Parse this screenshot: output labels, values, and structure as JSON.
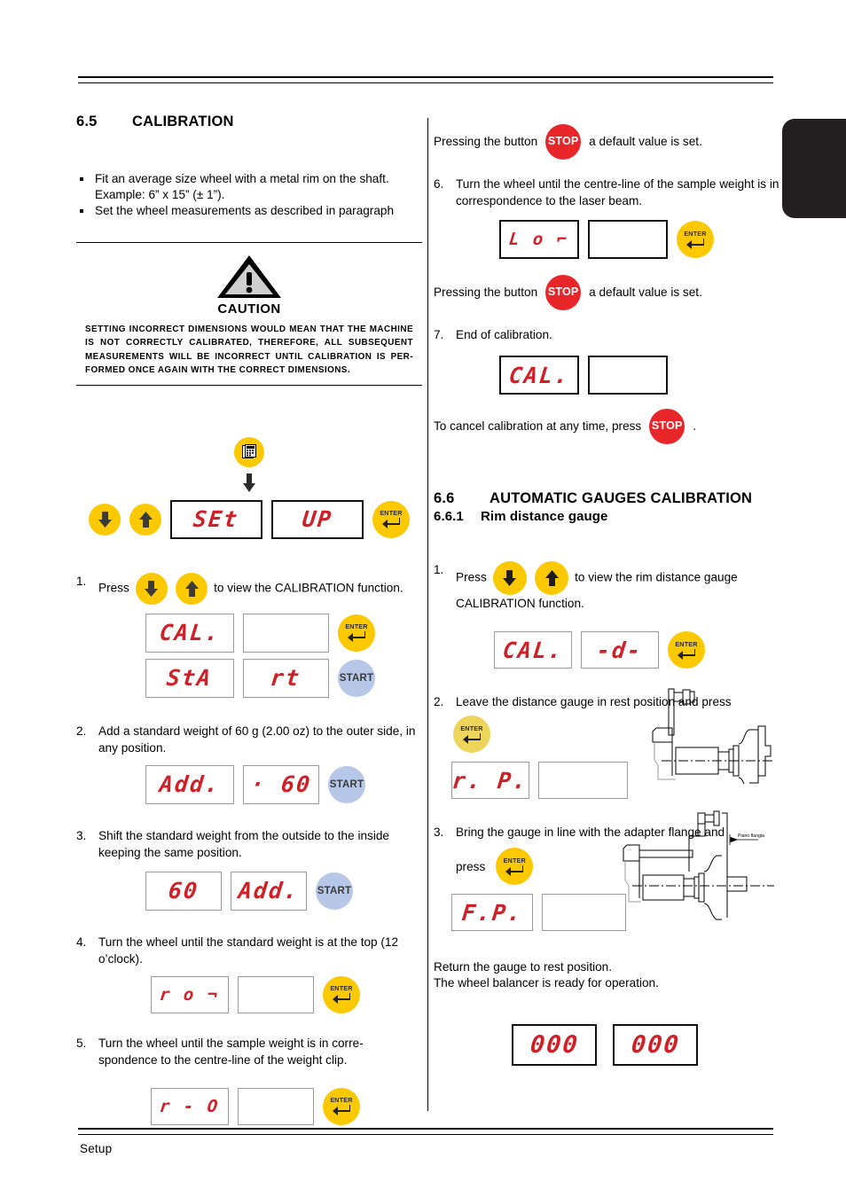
{
  "footer": {
    "label": "Setup"
  },
  "colors": {
    "yellow": "#fcc800",
    "yellow_pale": "#edd45a",
    "blue": "#b6c7e8",
    "red": "#e8262a",
    "segment_red": "#cf2027",
    "tab_dark": "#231f20"
  },
  "left": {
    "section": {
      "number": "6.5",
      "title": "CALIBRATION"
    },
    "bullets": [
      "Fit an average size wheel with a metal rim on the shaft. Example: 6” x 15” (± 1”).",
      "Set the wheel measurements as described in paragraph"
    ],
    "caution": {
      "title": "CAUTION",
      "icon": "warning-triangle-icon",
      "text": "SETTING INCORRECT DIMENSIONS WOULD MEAN THAT THE MACHINE IS NOT CORRECTLY CALIBRATED, THEREFORE, ALL SUBSEQUENT MEASUREMENTS WILL BE INCORRECT UNTIL CALIBRATION IS PER-FORMED ONCE AGAIN WITH THE CORRECT DIMENSIONS."
    },
    "setup_block": {
      "menu_icon": "menu-keypad-icon",
      "down_icon": "arrow-down-icon",
      "up_icon": "arrow-up-icon",
      "display_left": "SEt",
      "display_right": "UP",
      "enter_label": "ENTER"
    },
    "steps": [
      {
        "number": "1.",
        "text_before": "Press",
        "text_after": "to view the CALIBRATION function.",
        "displays": [
          {
            "left": "CAL.",
            "right": "",
            "button": "ENTER"
          },
          {
            "left": "StA",
            "right": "rt",
            "button": "START"
          }
        ]
      },
      {
        "number": "2.",
        "text": "Add a standard weight of 60 g (2.00 oz) to the outer side, in any position.",
        "displays": [
          {
            "left": "Add.",
            "right": "· 60",
            "button": "START"
          }
        ]
      },
      {
        "number": "3.",
        "text": "Shift the standard weight from the outside to the inside keeping the same position.",
        "displays": [
          {
            "left": "60",
            "right": "Add.",
            "button": "START"
          }
        ]
      },
      {
        "number": "4.",
        "text": "Turn the wheel until the standard weight is at the top (12 o’clock).",
        "displays": [
          {
            "left": "r o ¬",
            "right": "",
            "button": "ENTER"
          }
        ]
      },
      {
        "number": "5.",
        "text": "Turn the wheel until the sample weight is in corre-spondence to the centre-line of the weight clip.",
        "displays": [
          {
            "left": "r - O",
            "right": "",
            "button": "ENTER"
          }
        ]
      }
    ]
  },
  "right": {
    "stop_note_1": {
      "before": "Pressing the button",
      "after": "a default value is set.",
      "button": "STOP"
    },
    "step6": {
      "number": "6.",
      "text": "Turn the wheel until the centre-line of the sample weight is in correspondence to the laser beam.",
      "display": {
        "left": "L o ⌐",
        "right": "",
        "button": "ENTER"
      }
    },
    "stop_note_2": {
      "before": "Pressing the button",
      "after": "a default value is set.",
      "button": "STOP"
    },
    "step7": {
      "number": "7.",
      "text": "End of calibration.",
      "display": {
        "left": "CAL.",
        "right": ""
      }
    },
    "cancel_note": {
      "before": "To cancel calibration at any time, press",
      "after": ".",
      "button": "STOP"
    },
    "section": {
      "number": "6.6",
      "title": "AUTOMATIC GAUGES CALIBRATION"
    },
    "subsection": {
      "number": "6.6.1",
      "title": "Rim distance gauge"
    },
    "steps": [
      {
        "number": "1.",
        "text_before": "Press",
        "text_after": "to view the rim distance gauge CALIBRATION function.",
        "display": {
          "left": "CAL.",
          "right": "-d-",
          "button": "ENTER"
        }
      },
      {
        "number": "2.",
        "text": "Leave the distance gauge in rest position and press",
        "button": "ENTER",
        "display": {
          "left": "r. P.",
          "right": ""
        },
        "drawing": "gauge-rest-position-drawing"
      },
      {
        "number": "3.",
        "text_before": "Bring the gauge in line with the adapter flange and",
        "text_press": "press",
        "button": "ENTER",
        "display": {
          "left": "F.P.",
          "right": ""
        },
        "drawing": "gauge-flange-position-drawing",
        "drawing_label": "Piano flangia"
      }
    ],
    "closing": [
      "Return the gauge to rest position.",
      "The wheel balancer is ready for operation."
    ],
    "final_display": {
      "left": "000",
      "right": "000"
    }
  }
}
